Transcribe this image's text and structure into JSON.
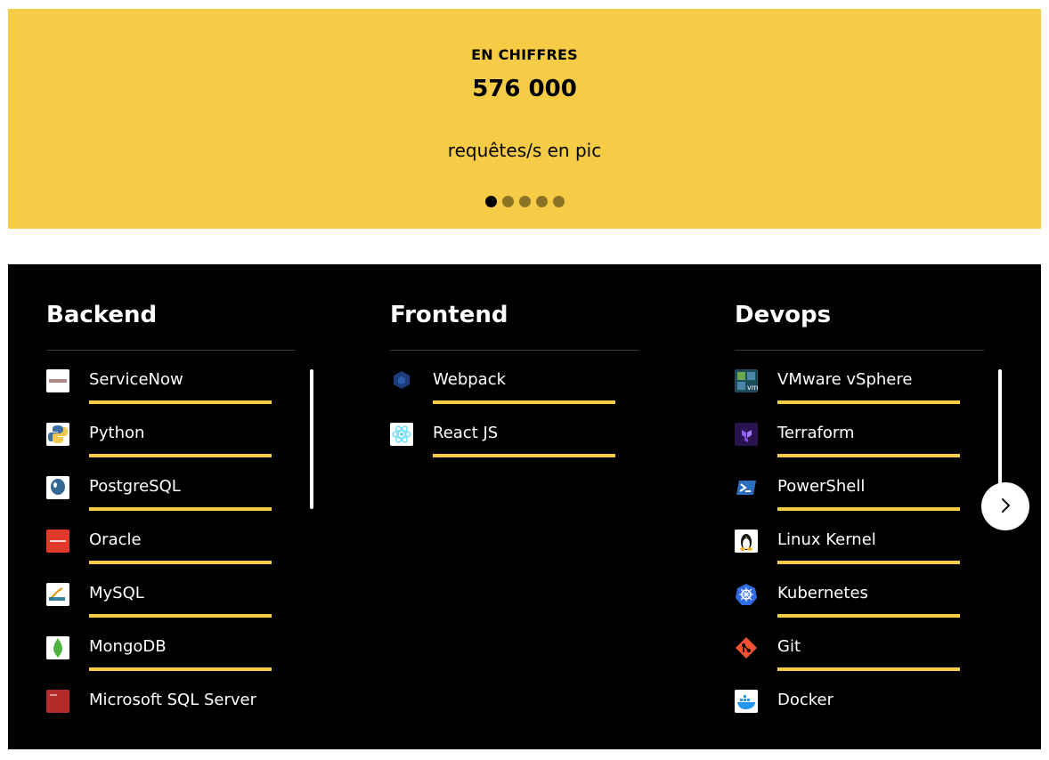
{
  "banner": {
    "kicker": "EN CHIFFRES",
    "value": "576 000",
    "caption": "requêtes/s en pic",
    "dots": 5,
    "active_dot": 0,
    "background": "#f6cb45"
  },
  "columns": [
    {
      "title": "Backend",
      "items": [
        {
          "label": "ServiceNow",
          "icon": "servicenow-icon"
        },
        {
          "label": "Python",
          "icon": "python-icon"
        },
        {
          "label": "PostgreSQL",
          "icon": "postgresql-icon"
        },
        {
          "label": "Oracle",
          "icon": "oracle-icon"
        },
        {
          "label": "MySQL",
          "icon": "mysql-icon"
        },
        {
          "label": "MongoDB",
          "icon": "mongodb-icon"
        },
        {
          "label": "Microsoft SQL Server",
          "icon": "sqlserver-icon"
        }
      ]
    },
    {
      "title": "Frontend",
      "items": [
        {
          "label": "Webpack",
          "icon": "webpack-icon"
        },
        {
          "label": "React JS",
          "icon": "react-icon"
        }
      ]
    },
    {
      "title": "Devops",
      "items": [
        {
          "label": "VMware vSphere",
          "icon": "vmware-icon"
        },
        {
          "label": "Terraform",
          "icon": "terraform-icon"
        },
        {
          "label": "PowerShell",
          "icon": "powershell-icon"
        },
        {
          "label": "Linux Kernel",
          "icon": "linux-icon"
        },
        {
          "label": "Kubernetes",
          "icon": "kubernetes-icon"
        },
        {
          "label": "Git",
          "icon": "git-icon"
        },
        {
          "label": "Docker",
          "icon": "docker-icon"
        }
      ]
    }
  ],
  "accent": "#f6cb45",
  "next_button": {
    "icon": "chevron-right-icon"
  }
}
